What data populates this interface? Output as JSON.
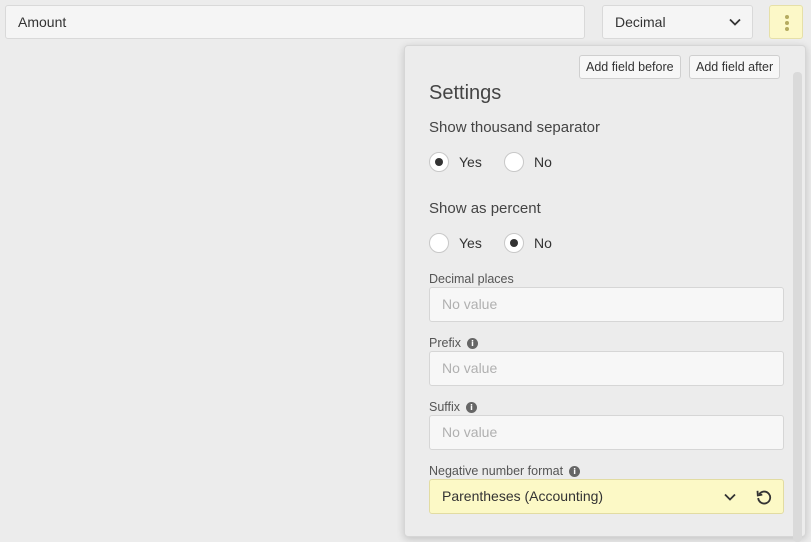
{
  "field": {
    "name_value": "Amount",
    "type_value": "Decimal"
  },
  "panel": {
    "add_before_label": "Add field before",
    "add_after_label": "Add field after",
    "title": "Settings",
    "thousand_separator": {
      "label": "Show thousand separator",
      "options": [
        "Yes",
        "No"
      ],
      "selected": "Yes"
    },
    "percent": {
      "label": "Show as percent",
      "options": [
        "Yes",
        "No"
      ],
      "selected": "No"
    },
    "decimal_places": {
      "label": "Decimal places",
      "placeholder": "No value"
    },
    "prefix": {
      "label": "Prefix",
      "placeholder": "No value"
    },
    "suffix": {
      "label": "Suffix",
      "placeholder": "No value"
    },
    "negative_format": {
      "label": "Negative number format",
      "value": "Parentheses (Accounting)"
    }
  },
  "colors": {
    "highlight": "#fcf9c6",
    "background": "#ececec"
  }
}
